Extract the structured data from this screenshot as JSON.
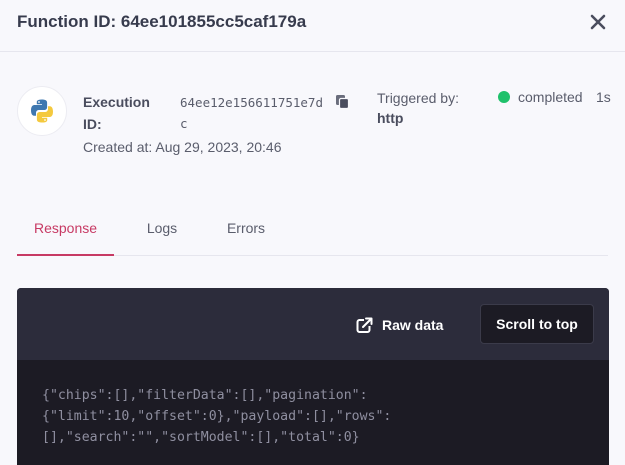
{
  "header": {
    "title": "Function ID: 64ee101855cc5caf179a",
    "close_icon": "close-icon"
  },
  "execution": {
    "avatar_icon": "python-logo-icon",
    "label": "Execution ID:",
    "id": "64ee12e156611751e7dc",
    "copy_icon": "copy-icon",
    "created_at": "Created at: Aug 29, 2023, 20:46",
    "triggered_label": "Triggered by:",
    "triggered_value": "http",
    "status": "completed",
    "status_color": "#1fc16b",
    "duration": "1s"
  },
  "tabs": [
    {
      "label": "Response",
      "active": true
    },
    {
      "label": "Logs",
      "active": false
    },
    {
      "label": "Errors",
      "active": false
    }
  ],
  "panel": {
    "raw_data_label": "Raw data",
    "raw_data_icon": "external-link-icon",
    "scroll_top_label": "Scroll to top",
    "code_lines": [
      "{\"chips\":[],\"filterData\":[],\"pagination\":",
      "{\"limit\":10,\"offset\":0},\"payload\":[],\"rows\":",
      "[],\"search\":\"\",\"sortModel\":[],\"total\":0}"
    ]
  },
  "colors": {
    "accent": "#c73a64",
    "panel_bg": "#1c1b24",
    "toolbar_bg": "#2c2c3b"
  }
}
